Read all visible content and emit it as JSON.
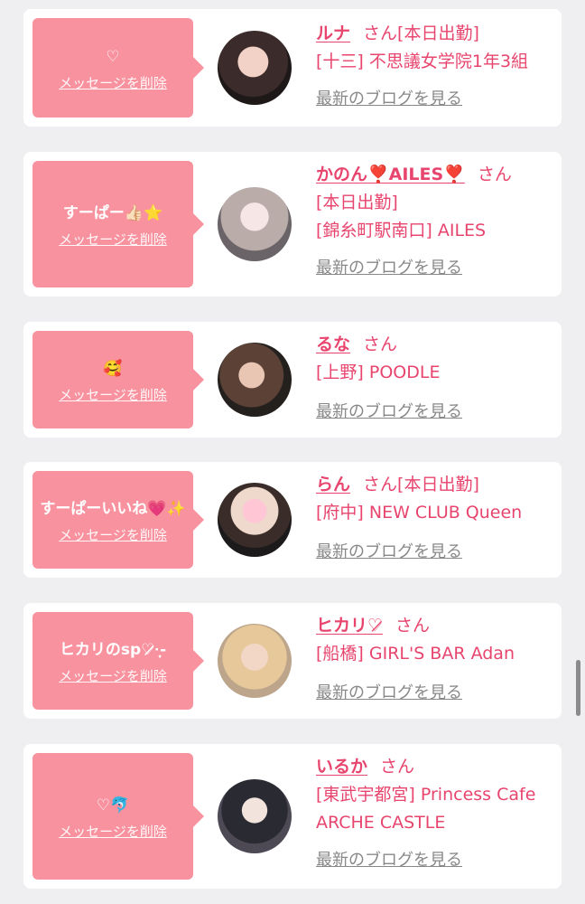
{
  "cards": [
    {
      "message": "♡",
      "delete_label": "メッセージを削除",
      "name": "ルナ",
      "san": "さん",
      "status": "[本日出勤]",
      "lines": [
        "[十三] 不思議女学院1年3組"
      ],
      "blog_label": "最新のブログを見る"
    },
    {
      "message": "すーぱー👍🏻⭐️",
      "delete_label": "メッセージを削除",
      "name": "かのん❣️AILES❣️",
      "san": "さん",
      "status": "",
      "lines": [
        "[本日出勤]",
        "[錦糸町駅南口] AILES"
      ],
      "blog_label": "最新のブログを見る"
    },
    {
      "message": "🥰",
      "delete_label": "メッセージを削除",
      "name": "るな",
      "san": "さん",
      "status": "",
      "lines": [
        "[上野] POODLE"
      ],
      "blog_label": "最新のブログを見る"
    },
    {
      "message": "すーぱーいいね💗✨",
      "delete_label": "メッセージを削除",
      "name": "らん",
      "san": "さん",
      "status": "[本日出勤]",
      "lines": [
        "[府中] NEW CLUB Queen"
      ],
      "blog_label": "最新のブログを見る"
    },
    {
      "message": "ヒカリのsp♡̷̷̷·̩͙-",
      "delete_label": "メッセージを削除",
      "name": "ヒカリ♡̷",
      "san": "さん",
      "status": "",
      "lines": [
        "[船橋] GIRL'S BAR Adan"
      ],
      "blog_label": "最新のブログを見る"
    },
    {
      "message": "♡🐬",
      "delete_label": "メッセージを削除",
      "name": "いるか",
      "san": "さん",
      "status": "",
      "lines": [
        "[東武宇都宮] Princess Cafe",
        "ARCHE CASTLE"
      ],
      "blog_label": "最新のブログを見る"
    }
  ],
  "colors": {
    "accent": "#e8456e",
    "bubble": "#f8929f",
    "background": "#efeff1"
  }
}
